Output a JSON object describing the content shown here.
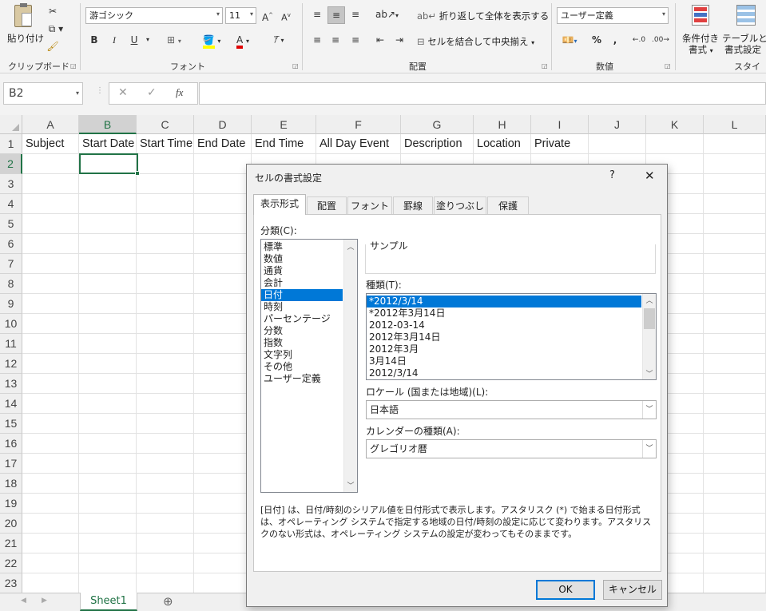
{
  "ribbon": {
    "clipboard": {
      "paste": "貼り付け",
      "label": "クリップボード"
    },
    "font": {
      "family": "游ゴシック",
      "size": "11",
      "bold": "B",
      "italic": "I",
      "underline": "U",
      "label": "フォント"
    },
    "alignment": {
      "wrap": "折り返して全体を表示する",
      "merge": "セルを結合して中央揃え",
      "label": "配置"
    },
    "number": {
      "format": "ユーザー定義",
      "percent": "%",
      "comma": ",",
      "label": "数値"
    },
    "styles": {
      "conditional": "条件付き\n書式",
      "conditional_l1": "条件付き",
      "conditional_l2": "書式",
      "table_l1": "テーブルとし",
      "table_l2": "書式設定",
      "label": "スタイル"
    }
  },
  "formula_bar": {
    "name_box": "B2",
    "cancel": "✕",
    "enter": "✓",
    "fx": "fx",
    "value": ""
  },
  "grid": {
    "columns": [
      "A",
      "B",
      "C",
      "D",
      "E",
      "F",
      "G",
      "H",
      "I",
      "J",
      "K",
      "L"
    ],
    "rows": [
      "1",
      "2",
      "3",
      "4",
      "5",
      "6",
      "7",
      "8",
      "9",
      "10",
      "11",
      "12",
      "13",
      "14",
      "15",
      "16",
      "17",
      "18",
      "19",
      "20",
      "21",
      "22",
      "23"
    ],
    "row1": [
      "Subject",
      "Start Date",
      "Start Time",
      "End Date",
      "End Time",
      "All Day Event",
      "Description",
      "Location",
      "Private"
    ],
    "selected_cell": "B2"
  },
  "sheet_tabs": {
    "active": "Sheet1",
    "add": "⊕"
  },
  "dialog": {
    "title": "セルの書式設定",
    "help": "?",
    "close": "✕",
    "tabs": [
      "表示形式",
      "配置",
      "フォント",
      "罫線",
      "塗りつぶし",
      "保護"
    ],
    "active_tab": "表示形式",
    "category_label": "分類(C):",
    "categories": [
      "標準",
      "数値",
      "通貨",
      "会計",
      "日付",
      "時刻",
      "パーセンテージ",
      "分数",
      "指数",
      "文字列",
      "その他",
      "ユーザー定義"
    ],
    "selected_category": "日付",
    "sample_label": "サンプル",
    "sample_value": "",
    "type_label": "種類(T):",
    "types": [
      "*2012/3/14",
      "*2012年3月14日",
      "2012-03-14",
      "2012年3月14日",
      "2012年3月",
      "3月14日",
      "2012/3/14"
    ],
    "selected_type": "*2012/3/14",
    "locale_label": "ロケール (国または地域)(L):",
    "locale_value": "日本語",
    "calendar_label": "カレンダーの種類(A):",
    "calendar_value": "グレゴリオ暦",
    "description": "[日付] は、日付/時刻のシリアル値を日付形式で表示します。アスタリスク (*) で始まる日付形式は、オペレーティング システムで指定する地域の日付/時刻の設定に応じて変わります。アスタリスクのない形式は、オペレーティング システムの設定が変わってもそのままです。",
    "ok": "OK",
    "cancel": "キャンセル"
  },
  "colors": {
    "accent": "#0078d7",
    "selected_cell_border": "#217346",
    "sheet_tab_text": "#217346"
  }
}
